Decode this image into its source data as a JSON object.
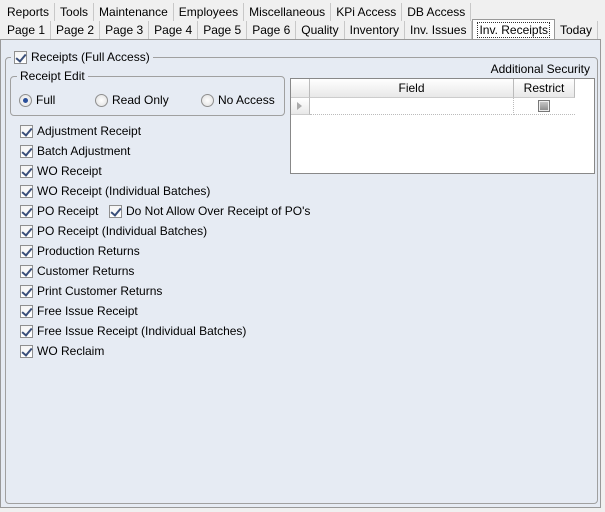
{
  "tabs_row1": [
    {
      "label": "Reports"
    },
    {
      "label": "Tools"
    },
    {
      "label": "Maintenance"
    },
    {
      "label": "Employees"
    },
    {
      "label": "Miscellaneous"
    },
    {
      "label": "KPi Access"
    },
    {
      "label": "DB Access"
    }
  ],
  "tabs_row2": [
    {
      "label": "Page 1"
    },
    {
      "label": "Page 2"
    },
    {
      "label": "Page 3"
    },
    {
      "label": "Page 4"
    },
    {
      "label": "Page 5"
    },
    {
      "label": "Page 6"
    },
    {
      "label": "Quality"
    },
    {
      "label": "Inventory"
    },
    {
      "label": "Inv. Issues"
    },
    {
      "label": "Inv. Receipts",
      "active": true
    },
    {
      "label": "Today"
    }
  ],
  "receipts": {
    "label": "Receipts (Full Access)",
    "checked": true
  },
  "receipt_edit": {
    "title": "Receipt Edit",
    "options": [
      {
        "label": "Full",
        "selected": true
      },
      {
        "label": "Read Only",
        "selected": false
      },
      {
        "label": "No Access",
        "selected": false
      }
    ]
  },
  "additional_security": {
    "title": "Additional Security",
    "columns": [
      "Field",
      "Restrict"
    ]
  },
  "checkboxes": [
    {
      "label": "Adjustment Receipt",
      "checked": true
    },
    {
      "label": "Batch Adjustment",
      "checked": true
    },
    {
      "label": "WO Receipt",
      "checked": true
    },
    {
      "label": "WO Receipt (Individual Batches)",
      "checked": true
    },
    {
      "label": "PO Receipt",
      "checked": true
    },
    {
      "label": "PO Receipt (Individual Batches)",
      "checked": true
    },
    {
      "label": "Production Returns",
      "checked": true
    },
    {
      "label": "Customer Returns",
      "checked": true
    },
    {
      "label": "Print Customer Returns",
      "checked": true
    },
    {
      "label": "Free Issue Receipt",
      "checked": true
    },
    {
      "label": "Free Issue Receipt (Individual Batches)",
      "checked": true
    },
    {
      "label": "WO Reclaim",
      "checked": true
    }
  ],
  "po_over_receipt": {
    "label": "Do Not Allow Over Receipt of PO's",
    "checked": true
  }
}
